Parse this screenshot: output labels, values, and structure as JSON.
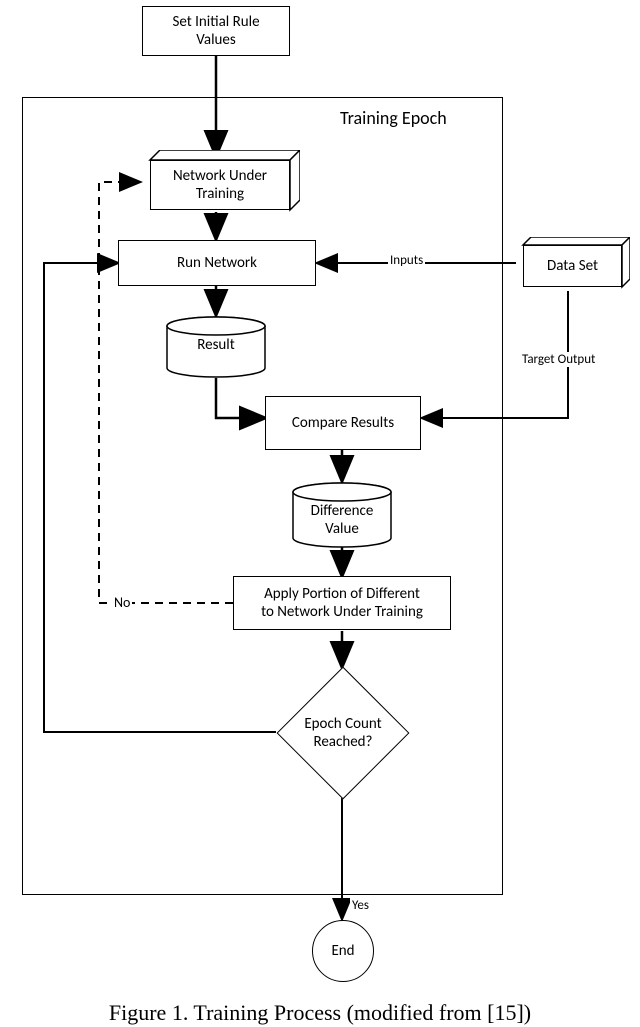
{
  "nodes": {
    "init": "Set Initial Rule\nValues",
    "frame": "Training Epoch",
    "network": "Network Under\nTraining",
    "run": "Run Network",
    "result": "Result",
    "compare": "Compare Results",
    "diff": "Difference\nValue",
    "apply": "Apply Portion of Different\nto Network Under Training",
    "epoch": "Epoch Count\nReached?",
    "end": "End",
    "dataset": "Data Set"
  },
  "labels": {
    "inputs": "Inputs",
    "target": "Target Output",
    "no": "No",
    "yes": "Yes"
  },
  "caption": "Figure 1. Training Process (modified from [15])"
}
